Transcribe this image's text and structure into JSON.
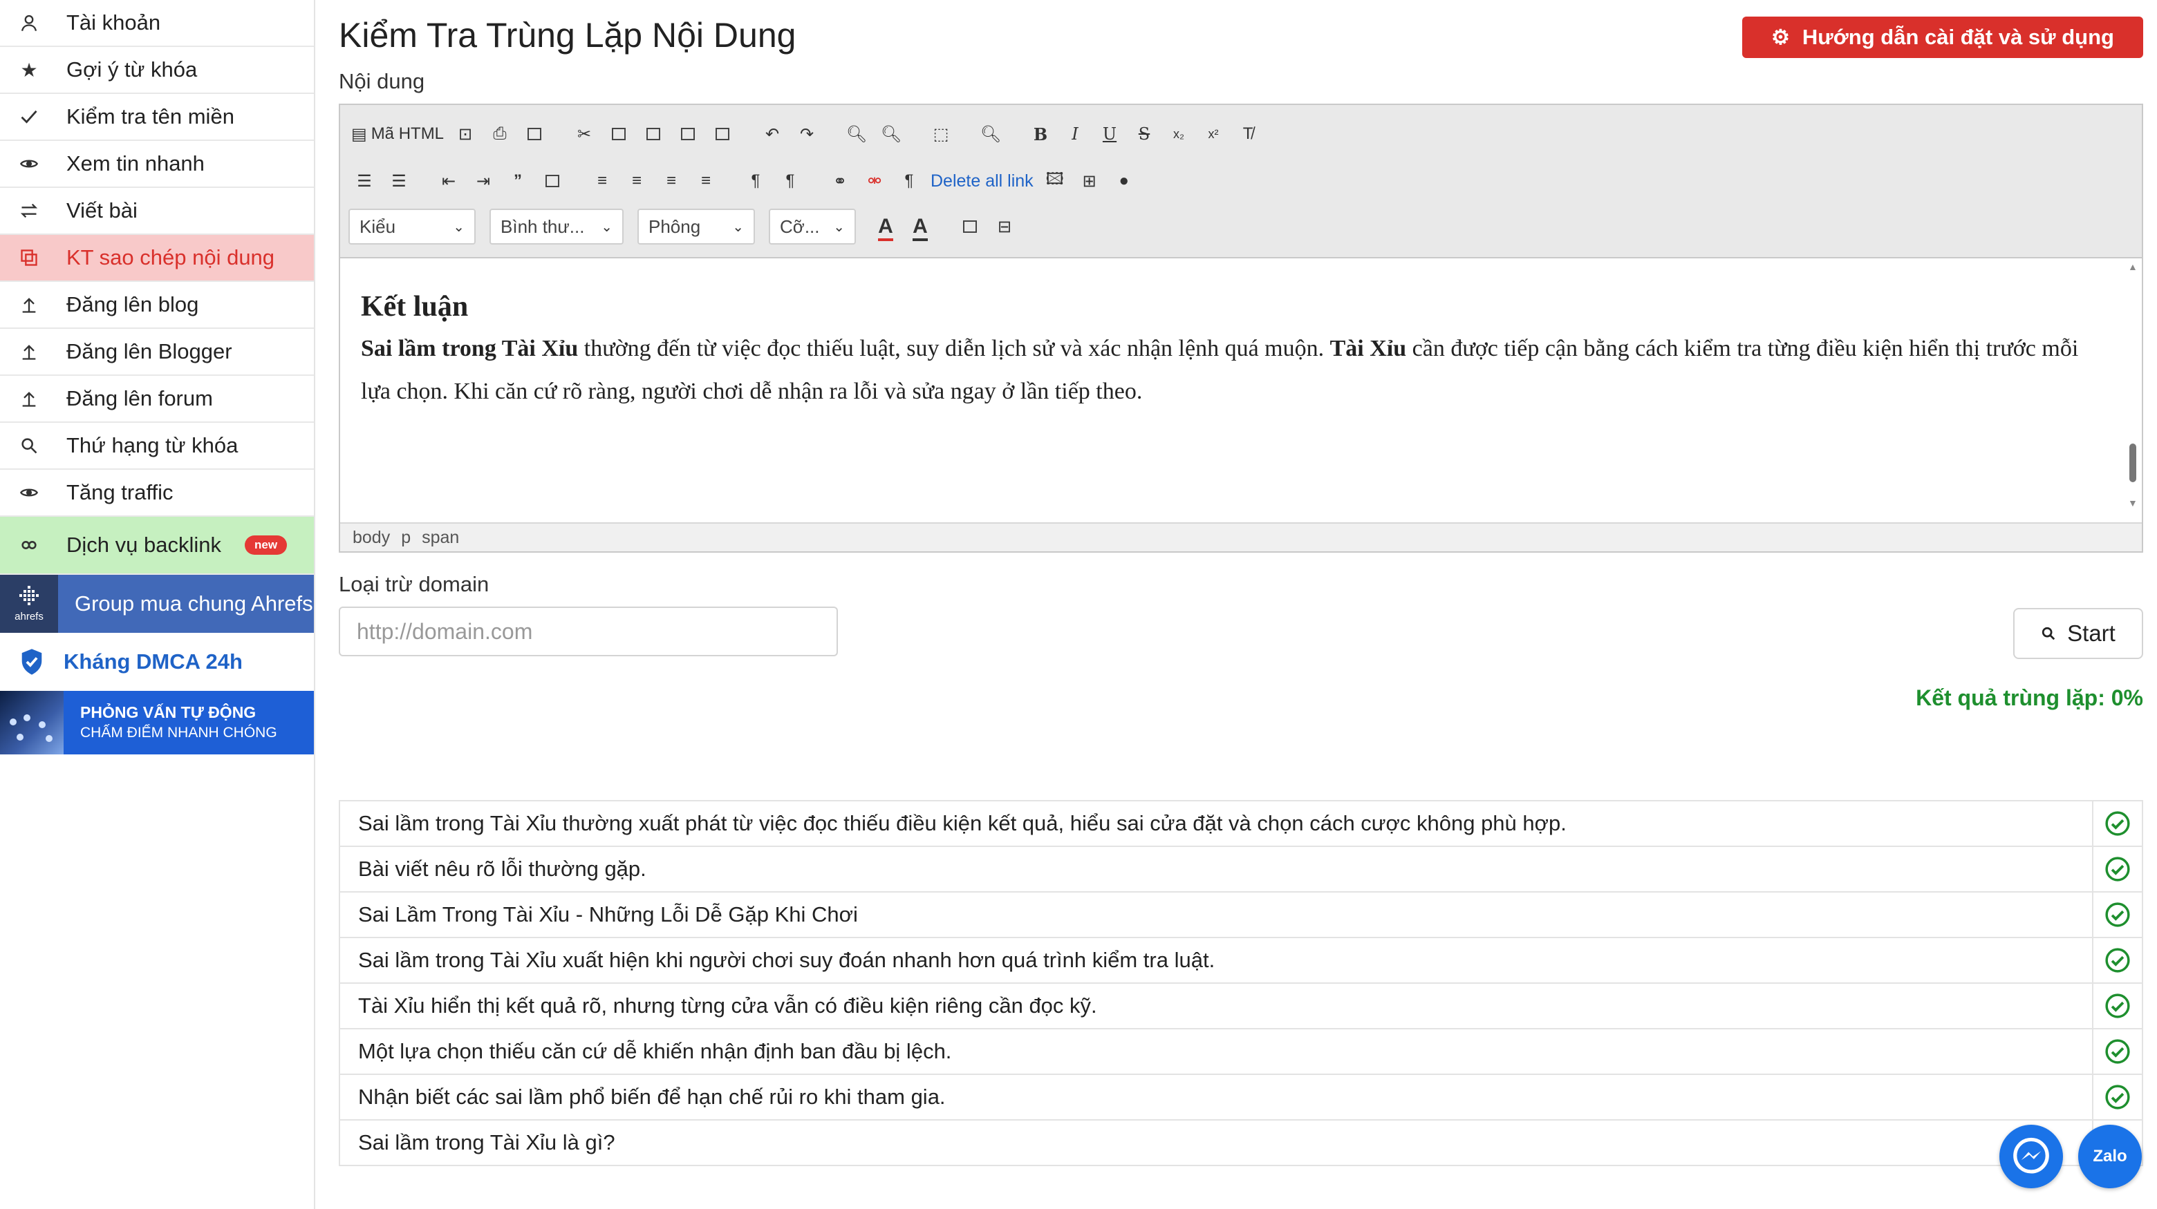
{
  "sidebar": {
    "items": [
      {
        "label": "Tài khoản",
        "icon": "user-icon"
      },
      {
        "label": "Gợi ý từ khóa",
        "icon": "star-icon"
      },
      {
        "label": "Kiểm tra tên miền",
        "icon": "check-icon"
      },
      {
        "label": "Xem tin nhanh",
        "icon": "eye-icon"
      },
      {
        "label": "Viết bài",
        "icon": "swap-icon"
      },
      {
        "label": "KT sao chép nội dung",
        "icon": "copy-icon",
        "active": true
      },
      {
        "label": "Đăng lên blog",
        "icon": "upload-icon"
      },
      {
        "label": "Đăng lên Blogger",
        "icon": "upload-icon"
      },
      {
        "label": "Đăng lên forum",
        "icon": "upload-icon"
      },
      {
        "label": "Thứ hạng từ khóa",
        "icon": "search-icon"
      },
      {
        "label": "Tăng traffic",
        "icon": "eye-icon"
      }
    ],
    "backlink": {
      "label": "Dịch vụ backlink",
      "badge": "new",
      "icon": "link-icon"
    },
    "ahrefs": {
      "label": "Group mua chung Ahrefs",
      "logo_text": "ahrefs"
    },
    "dmca": {
      "label": "Kháng DMCA 24h",
      "icon": "shield-check-icon"
    },
    "interview": {
      "line1": "PHỎNG VẤN TỰ ĐỘNG",
      "line2": "CHẤM ĐIỂM NHANH CHÓNG"
    }
  },
  "header": {
    "title": "Kiểm Tra Trùng Lặp Nội Dung",
    "guide_button": "Hướng dẫn cài đặt và sử dụng"
  },
  "editor": {
    "label": "Nội dung",
    "toolbar": {
      "html_button": "Mã HTML",
      "delete_links": "Delete all link",
      "selects": {
        "style": "Kiểu",
        "format": "Bình thư...",
        "font": "Phông",
        "size": "Cỡ..."
      }
    },
    "content": {
      "heading": "Kết luận",
      "p_bold1": "Sai lầm trong Tài Xỉu",
      "p_text1": " thường đến từ việc đọc thiếu luật, suy diễn lịch sử và xác nhận lệnh quá muộn. ",
      "p_bold2": "Tài Xỉu",
      "p_text2": " cần được tiếp cận bằng cách kiểm tra từng điều kiện hiển thị trước mỗi lựa chọn. Khi căn cứ rõ ràng, người chơi dễ nhận ra lỗi và sửa ngay ở lần tiếp theo."
    },
    "status_path": [
      "body",
      "p",
      "span"
    ]
  },
  "exclude": {
    "label": "Loại trừ domain",
    "placeholder": "http://domain.com",
    "start_button": "Start"
  },
  "result": {
    "summary": "Kết quả trùng lặp: 0%",
    "rows": [
      {
        "text": "Sai lầm trong Tài Xỉu thường xuất phát từ việc đọc thiếu điều kiện kết quả, hiểu sai cửa đặt và chọn cách cược không phù hợp.",
        "ok": true
      },
      {
        "text": "Bài viết nêu rõ lỗi thường gặp.",
        "ok": true
      },
      {
        "text": "Sai Lầm Trong Tài Xỉu - Những Lỗi Dễ Gặp Khi Chơi",
        "ok": true
      },
      {
        "text": "Sai lầm trong Tài Xỉu xuất hiện khi người chơi suy đoán nhanh hơn quá trình kiểm tra luật.",
        "ok": true
      },
      {
        "text": "Tài Xỉu hiển thị kết quả rõ, nhưng từng cửa vẫn có điều kiện riêng cần đọc kỹ.",
        "ok": true
      },
      {
        "text": "Một lựa chọn thiếu căn cứ dễ khiến nhận định ban đầu bị lệch.",
        "ok": true
      },
      {
        "text": "Nhận biết các sai lầm phổ biến để hạn chế rủi ro khi tham gia.",
        "ok": true
      },
      {
        "text": "Sai lầm trong Tài Xỉu là gì?",
        "ok": false
      }
    ]
  },
  "floating": {
    "zalo_label": "Zalo"
  },
  "colors": {
    "brand_red": "#d9302b",
    "success_green": "#1e8f2e",
    "link_blue": "#1f63c7"
  }
}
